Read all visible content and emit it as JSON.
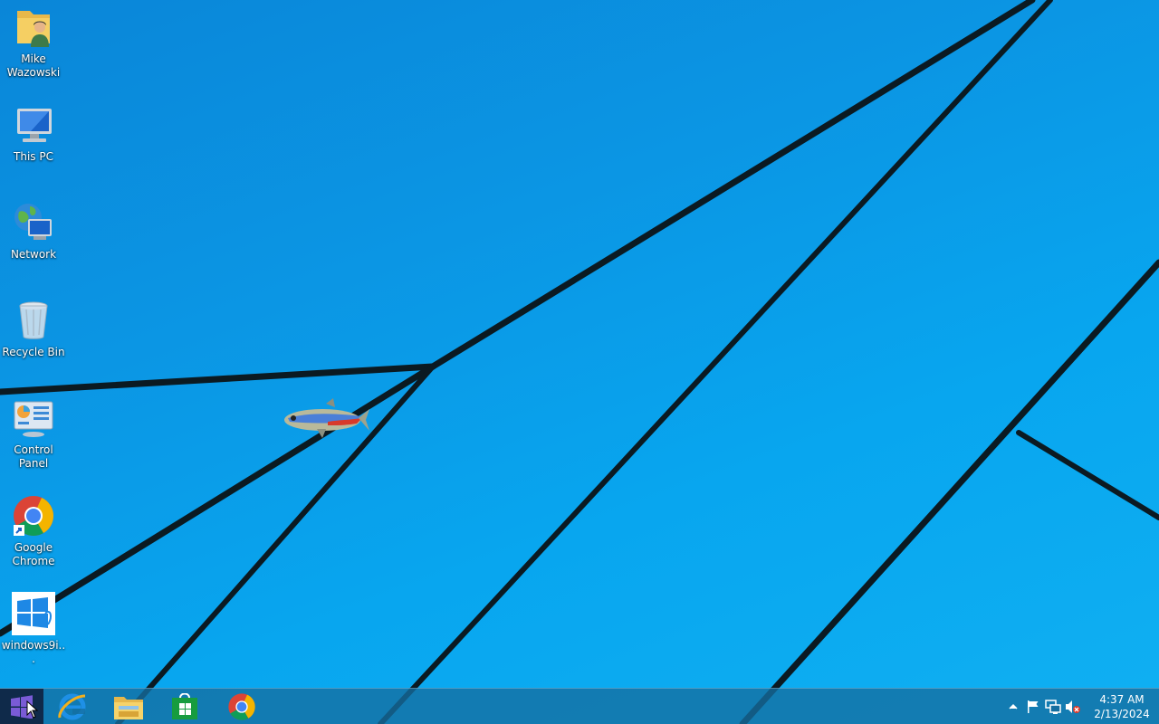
{
  "desktop": {
    "icons": [
      {
        "label": "Mike Wazowski",
        "icon": "user-folder-icon"
      },
      {
        "label": "This PC",
        "icon": "computer-icon"
      },
      {
        "label": "Network",
        "icon": "network-icon"
      },
      {
        "label": "Recycle Bin",
        "icon": "recycle-bin-icon"
      },
      {
        "label": "Control Panel",
        "icon": "control-panel-icon"
      },
      {
        "label": "Google Chrome",
        "icon": "chrome-icon"
      },
      {
        "label": "windows9i...",
        "icon": "windows-logo-icon"
      }
    ],
    "wallpaper": {
      "color_top": "#0a86d8",
      "color_bottom": "#10b0f2",
      "line_color": "#0b1a22"
    }
  },
  "taskbar": {
    "pinned": [
      {
        "name": "Internet Explorer",
        "icon": "internet-explorer-icon"
      },
      {
        "name": "File Explorer",
        "icon": "file-explorer-icon"
      },
      {
        "name": "Store",
        "icon": "store-icon"
      },
      {
        "name": "Google Chrome",
        "icon": "chrome-icon"
      }
    ],
    "tray": {
      "icons": [
        "chevron-up-icon",
        "flag-icon",
        "network-icon",
        "volume-muted-icon"
      ],
      "time": "4:37 AM",
      "date": "2/13/2024"
    }
  }
}
